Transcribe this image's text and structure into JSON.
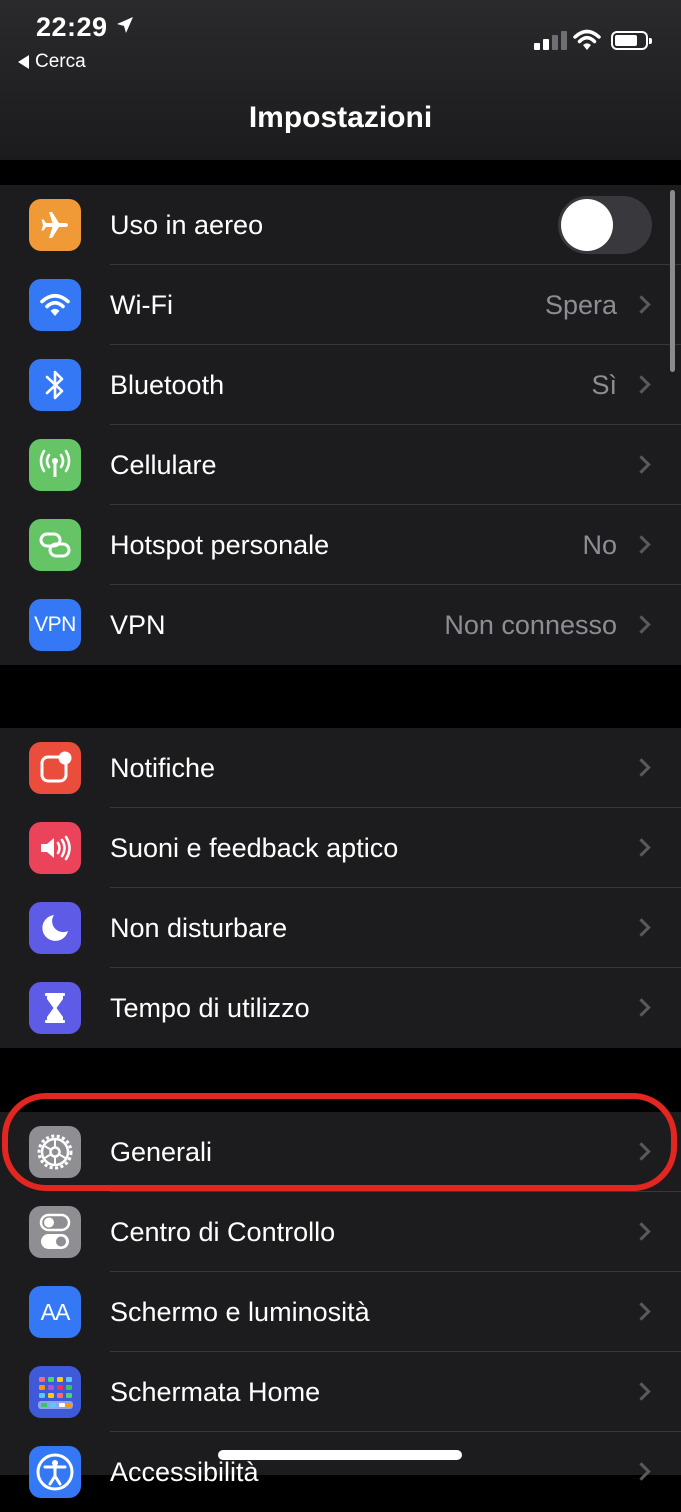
{
  "status_bar": {
    "time": "22:29",
    "back_label": "Cerca"
  },
  "nav": {
    "title": "Impostazioni"
  },
  "group1": [
    {
      "label": "Uso in aereo",
      "value": "",
      "icon": "airplane-icon",
      "color": "#f09a37",
      "toggle": false
    },
    {
      "label": "Wi-Fi",
      "value": "Spera",
      "icon": "wifi-icon",
      "color": "#3478f6"
    },
    {
      "label": "Bluetooth",
      "value": "Sì",
      "icon": "bluetooth-icon",
      "color": "#3478f6"
    },
    {
      "label": "Cellulare",
      "value": "",
      "icon": "antenna-icon",
      "color": "#65c466"
    },
    {
      "label": "Hotspot personale",
      "value": "No",
      "icon": "hotspot-icon",
      "color": "#65c466"
    },
    {
      "label": "VPN",
      "value": "Non connesso",
      "icon": "vpn-icon",
      "color": "#3478f6",
      "icon_text": "VPN"
    }
  ],
  "group2": [
    {
      "label": "Notifiche",
      "icon": "notifications-icon",
      "color": "#eb4d3d"
    },
    {
      "label": "Suoni e feedback aptico",
      "icon": "speaker-icon",
      "color": "#eb445a"
    },
    {
      "label": "Non disturbare",
      "icon": "moon-icon",
      "color": "#5e5ce6"
    },
    {
      "label": "Tempo di utilizzo",
      "icon": "hourglass-icon",
      "color": "#5e5ce6"
    }
  ],
  "group3": [
    {
      "label": "Generali",
      "icon": "gear-icon",
      "color": "#8e8e93"
    },
    {
      "label": "Centro di Controllo",
      "icon": "control-center-icon",
      "color": "#8e8e93"
    },
    {
      "label": "Schermo e luminosità",
      "icon": "text-size-icon",
      "color": "#3478f6",
      "icon_text": "AA"
    },
    {
      "label": "Schermata Home",
      "icon": "home-screen-icon",
      "color": "#3f5ad8"
    },
    {
      "label": "Accessibilità",
      "icon": "accessibility-icon",
      "color": "#3478f6"
    }
  ],
  "highlight_color": "#e3261f"
}
